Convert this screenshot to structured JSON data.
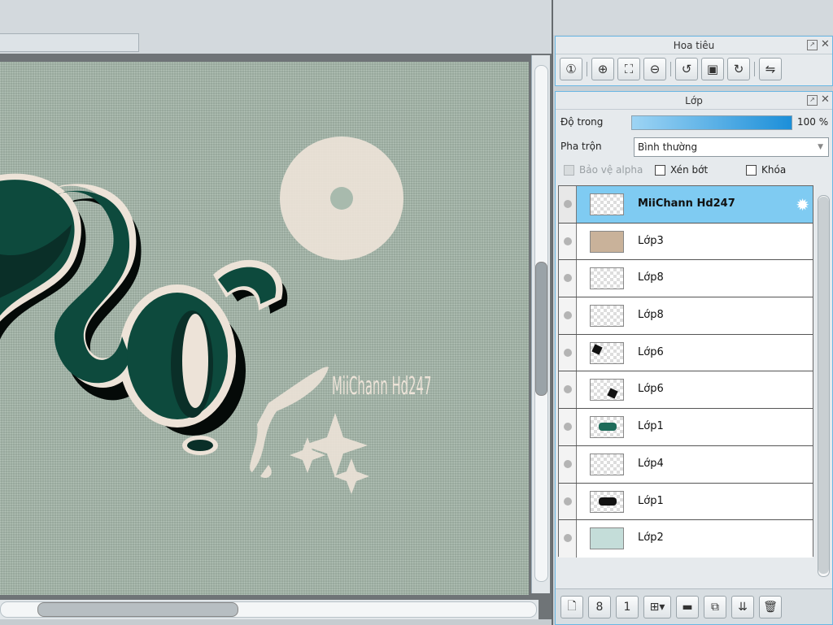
{
  "canvas": {
    "watermark": "MiiChann Hd247"
  },
  "navigator": {
    "title": "Hoa tiêu",
    "tools": [
      {
        "icon": "zoom-actual-icon",
        "glyph": "①"
      },
      {
        "icon": "zoom-in-icon",
        "glyph": "⊕"
      },
      {
        "icon": "fit-screen-icon",
        "glyph": "⛶"
      },
      {
        "icon": "zoom-out-icon",
        "glyph": "⊖"
      },
      {
        "icon": "rotate-left-icon",
        "glyph": "↺"
      },
      {
        "icon": "reset-view-icon",
        "glyph": "▣"
      },
      {
        "icon": "rotate-right-icon",
        "glyph": "↻"
      },
      {
        "icon": "flip-horizontal-icon",
        "glyph": "⇋"
      }
    ]
  },
  "layer_panel": {
    "title": "Lớp",
    "opacity_label": "Độ trong",
    "opacity_value": "100 %",
    "opacity": 1.0,
    "blend_label": "Pha trộn",
    "blend_value": "Bình thường",
    "protect_alpha": "Bảo vệ alpha",
    "clipping": "Xén bớt",
    "lock": "Khóa",
    "layers": [
      {
        "name": "MiiChann Hd247",
        "thumb": "checker",
        "selected": true
      },
      {
        "name": "Lớp3",
        "thumb": "tan",
        "selected": false
      },
      {
        "name": "Lớp8",
        "thumb": "checker",
        "selected": false
      },
      {
        "name": "Lớp8",
        "thumb": "checker",
        "selected": false
      },
      {
        "name": "Lớp6",
        "thumb": "checker",
        "selected": false
      },
      {
        "name": "Lớp6",
        "thumb": "checker",
        "selected": false
      },
      {
        "name": "Lớp1",
        "thumb": "checker",
        "selected": false
      },
      {
        "name": "Lớp4",
        "thumb": "checker",
        "selected": false
      },
      {
        "name": "Lớp1",
        "thumb": "checker",
        "selected": false
      },
      {
        "name": "Lớp2",
        "thumb": "mint",
        "selected": false
      }
    ],
    "bottom_tools": [
      {
        "icon": "new-layer-icon",
        "glyph": "🗋"
      },
      {
        "icon": "new-8bit-layer-icon",
        "glyph": "8"
      },
      {
        "icon": "new-1bit-layer-icon",
        "glyph": "1"
      },
      {
        "icon": "new-layer-menu-icon",
        "glyph": "⊞▾"
      },
      {
        "icon": "new-folder-icon",
        "glyph": "▬"
      },
      {
        "icon": "duplicate-layer-icon",
        "glyph": "⧉"
      },
      {
        "icon": "merge-down-icon",
        "glyph": "⇊"
      },
      {
        "icon": "delete-layer-icon",
        "glyph": "🗑"
      }
    ]
  },
  "colors": {
    "accent": "#7fcbf2",
    "canvas_bg": "#a8baad",
    "letter_green": "#0d4a3d",
    "cream": "#ede3d8"
  }
}
